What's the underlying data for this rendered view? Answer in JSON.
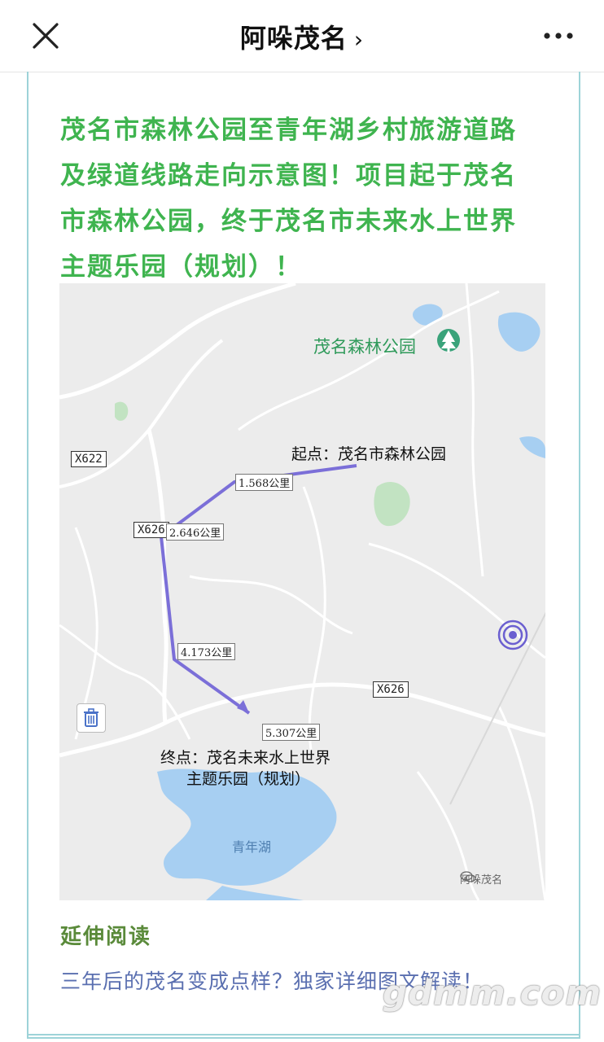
{
  "header": {
    "title": "阿哚茂名",
    "chevron": "›"
  },
  "article": {
    "headline_lines": [
      "茂名市森林公园至青年湖乡村旅游道路",
      "及绿道线路走向示意图！项目起于茂名",
      "市森林公园，终于茂名市未来水上世界",
      "主题乐园（规划）！"
    ],
    "headline_color": "#3fb44f"
  },
  "map": {
    "park_name": "茂名森林公园",
    "road_x622": "X622",
    "road_x626_left": "X626",
    "road_x626_right": "X626",
    "start_label": "起点：茂名市森林公园",
    "end_label_line1": "终点：茂名未来水上世界",
    "end_label_line2": "主题乐园（规划）",
    "distances": [
      "1.568公里",
      "2.646公里",
      "4.173公里",
      "5.307公里"
    ],
    "lake_name": "青年湖",
    "watermark": "阿哚茂名",
    "route_color": "#7b6fd8",
    "water_color": "#a7cff2",
    "park_color": "#c2e3c2"
  },
  "extended": {
    "heading": "延伸阅读",
    "link_text": "三年后的茂名变成点样？独家详细图文解读！"
  },
  "site_watermark": "gdmm.com"
}
